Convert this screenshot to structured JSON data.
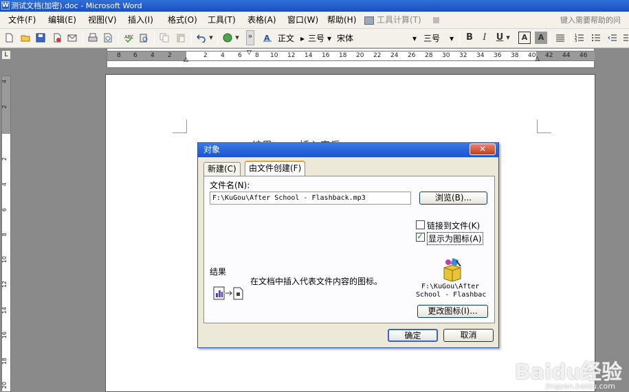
{
  "window": {
    "title": "测试文档(加密).doc - Microsoft Word"
  },
  "menubar": {
    "items": [
      "文件(F)",
      "编辑(E)",
      "视图(V)",
      "插入(I)",
      "格式(O)",
      "工具(T)",
      "表格(A)",
      "窗口(W)",
      "帮助(H)"
    ],
    "extra": "工具计算(T)",
    "help_placeholder": "键入需要帮助的问"
  },
  "toolbar": {
    "style": "正文",
    "size": "三号",
    "font": "宋体",
    "size2": "三号",
    "bold": "B",
    "italic": "I",
    "underline": "U",
    "charborder": "A",
    "charshade": "A"
  },
  "ruler": {
    "h_ticks": [
      "8",
      "6",
      "4",
      "2",
      "2",
      "4",
      "6",
      "8",
      "10",
      "12",
      "14",
      "16",
      "18",
      "20",
      "22",
      "24",
      "26",
      "28",
      "30",
      "32",
      "34",
      "36",
      "38",
      "40",
      "42",
      "44",
      "46"
    ],
    "v_ticks": [
      "4",
      "2",
      "2",
      "4",
      "6",
      "8",
      "10",
      "12",
      "14",
      "16",
      "18",
      "20"
    ]
  },
  "document": {
    "background_text": "结果 —— 插入音乐"
  },
  "dialog": {
    "title": "对象",
    "tabs": [
      "新建(C)",
      "由文件创建(F)"
    ],
    "filename_label": "文件名(N):",
    "filename_value": "F:\\KuGou\\After School - Flashback.mp3",
    "browse_button": "浏览(B)...",
    "link_checkbox": {
      "label": "链接到文件(K)",
      "checked": false
    },
    "icon_checkbox": {
      "label": "显示为图标(A)",
      "checked": true
    },
    "result_label": "结果",
    "result_text": "在文档中插入代表文件内容的图标。",
    "icon_caption_1": "F:\\KuGou\\After",
    "icon_caption_2": "School - Flashbac",
    "change_icon_button": "更改图标(I)...",
    "ok_button": "确定",
    "cancel_button": "取消"
  },
  "watermark": {
    "brand": "Baidu经验",
    "url": "jingyan.baidu.com"
  }
}
